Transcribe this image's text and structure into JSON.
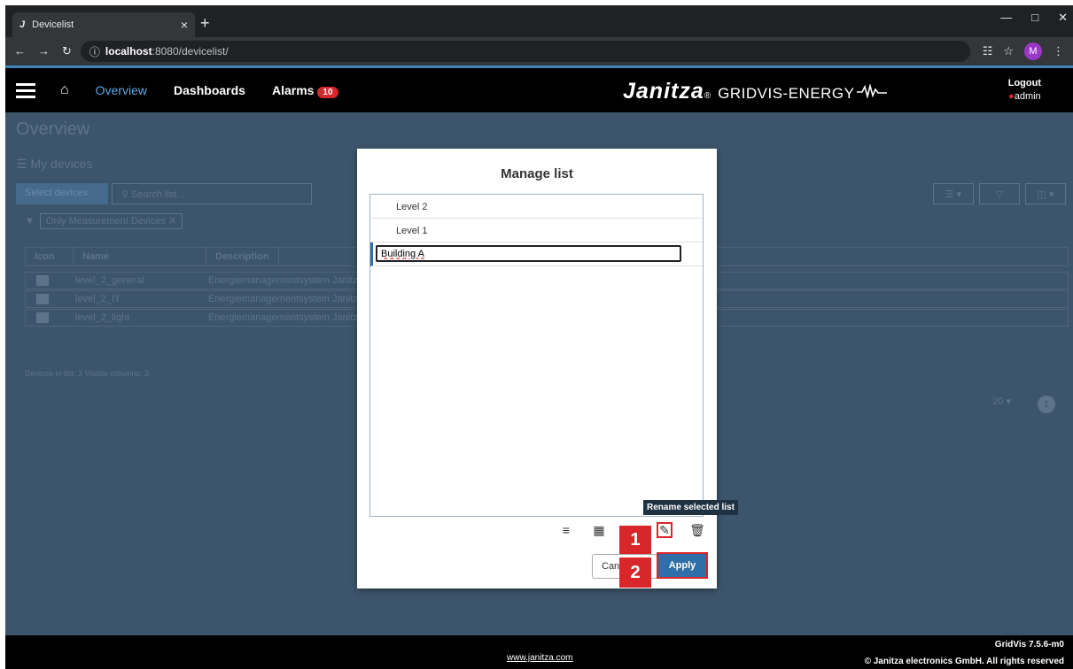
{
  "browser": {
    "tab_icon": "J",
    "tab_title": "Devicelist",
    "tab_close": "×",
    "new_tab": "+",
    "url_host": "localhost",
    "url_path": ":8080/devicelist/",
    "profile_initial": "M"
  },
  "header": {
    "overview": "Overview",
    "dashboards": "Dashboards",
    "alarms": "Alarms",
    "alarms_count": "10",
    "brand_logo": "Janitza",
    "brand_reg": "®",
    "brand_sub": "GRIDVIS-ENERGY",
    "logout": "Logout",
    "user": "admin"
  },
  "background": {
    "title": "Overview",
    "my_devices": "My devices",
    "select_devices": "Select devices",
    "search_placeholder": "Search list...",
    "filter_chip": "Only Measurement Devices",
    "columns": [
      "Icon",
      "Name",
      "Description"
    ],
    "rows": [
      {
        "name": "level_2_general",
        "description": "Energiemanagementsystem Janitza"
      },
      {
        "name": "level_2_IT",
        "description": "Energiemanagementsystem Janitza"
      },
      {
        "name": "level_2_light",
        "description": "Energiemanagementsystem Janitza"
      }
    ],
    "footer_text": "Devices in list: 3    Visible columns: 3",
    "page_size": "20",
    "page": "1"
  },
  "modal": {
    "title": "Manage list",
    "items": [
      "Level 2",
      "Level 1"
    ],
    "edit_value": "Building A",
    "tooltip": "Rename selected list",
    "cancel": "Cancel",
    "apply": "Apply"
  },
  "markers": {
    "one": "1",
    "two": "2"
  },
  "footer": {
    "link": "www.janitza.com",
    "version": "GridVis 7.5.6-m0",
    "copyright": "© Janitza electronics GmbH. All rights reserved"
  },
  "colors": {
    "accent": "#2f6fa7",
    "highlight": "#d9262a",
    "overlay": "#3d556c"
  }
}
